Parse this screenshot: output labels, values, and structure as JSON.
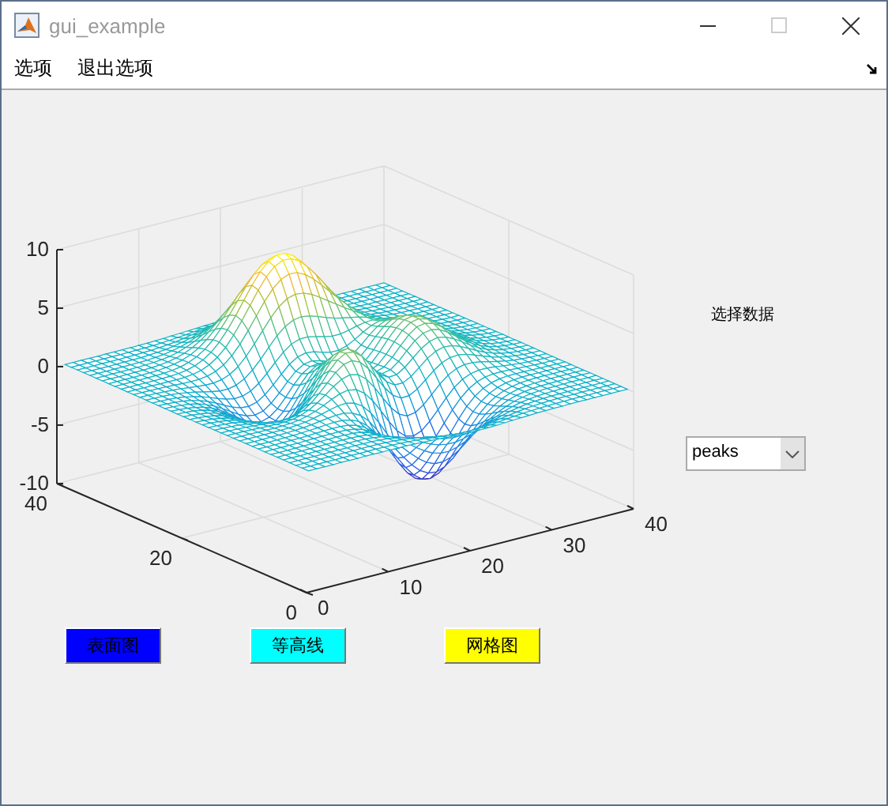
{
  "window": {
    "title": "gui_example"
  },
  "menu": [
    {
      "label": "选项"
    },
    {
      "label": "退出选项"
    }
  ],
  "plot": {
    "xticks": [
      "0",
      "10",
      "20",
      "30",
      "40"
    ],
    "yticks": [
      "40",
      "20",
      "0"
    ],
    "zticks": [
      "10",
      "5",
      "0",
      "-5",
      "-10"
    ]
  },
  "data_label": "选择数据",
  "dropdown": {
    "value": "peaks"
  },
  "buttons": [
    {
      "label": "表面图",
      "color": "#0000ff"
    },
    {
      "label": "等高线",
      "color": "#00ffff"
    },
    {
      "label": "网格图",
      "color": "#ffff00"
    }
  ]
}
